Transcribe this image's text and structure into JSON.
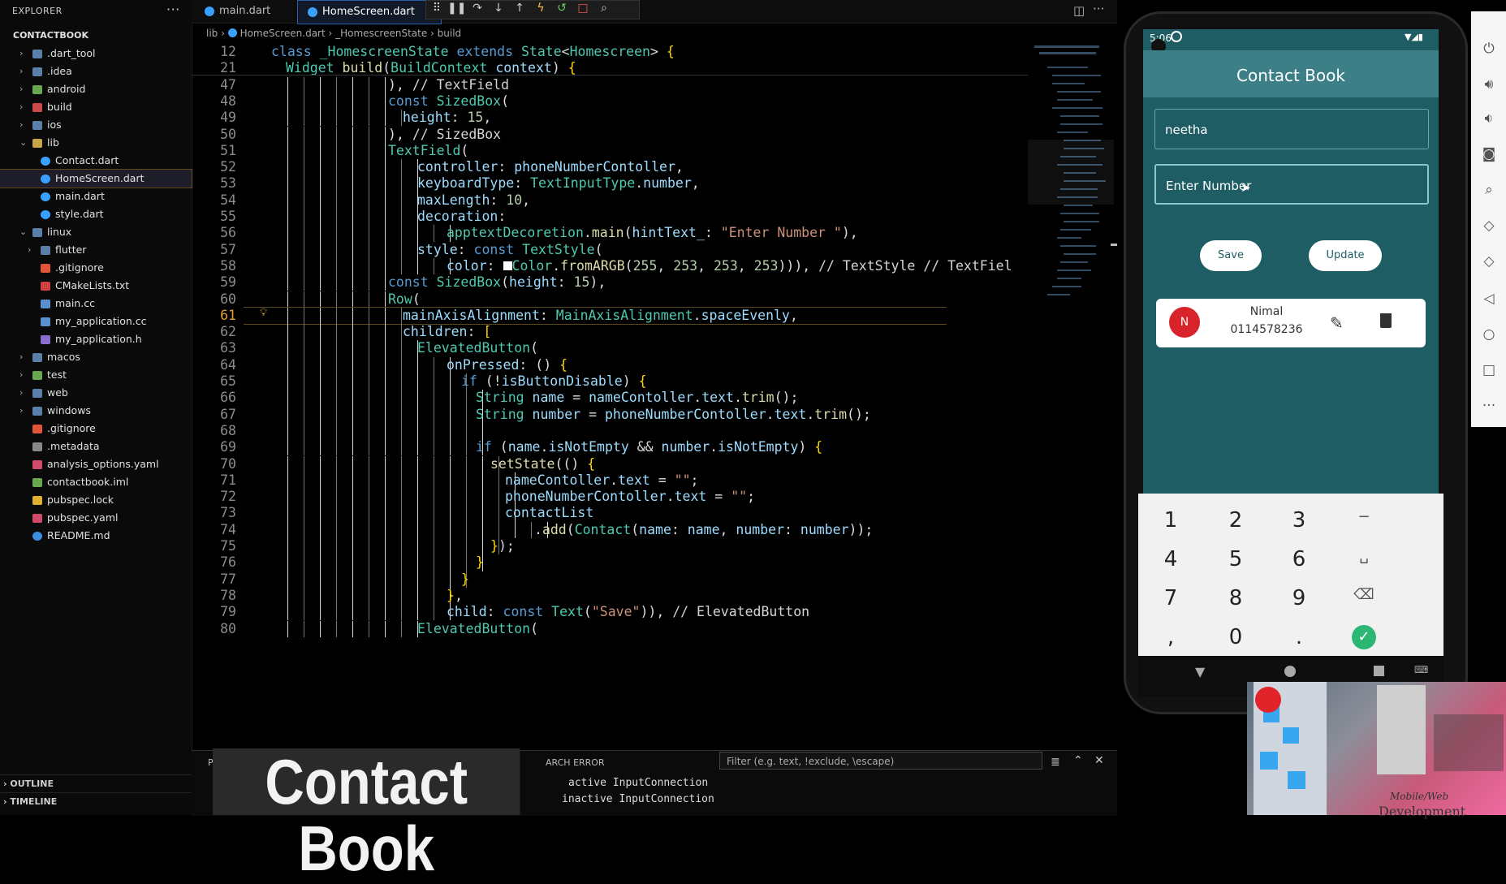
{
  "explorer": {
    "title": "EXPLORER",
    "more": "···",
    "items": [
      {
        "label": "CONTACTBOOK",
        "depth": 0,
        "chev": "v",
        "icon": "none",
        "bold": true
      },
      {
        "label": ".dart_tool",
        "depth": 1,
        "chev": ">",
        "icon": "folder"
      },
      {
        "label": ".idea",
        "depth": 1,
        "chev": ">",
        "icon": "folder"
      },
      {
        "label": "android",
        "depth": 1,
        "chev": ">",
        "icon": "folder-green"
      },
      {
        "label": "build",
        "depth": 1,
        "chev": ">",
        "icon": "folder-red"
      },
      {
        "label": "ios",
        "depth": 1,
        "chev": ">",
        "icon": "folder"
      },
      {
        "label": "lib",
        "depth": 1,
        "chev": "v",
        "icon": "folder-open"
      },
      {
        "label": "Contact.dart",
        "depth": 2,
        "chev": "",
        "icon": "dart"
      },
      {
        "label": "HomeScreen.dart",
        "depth": 2,
        "chev": "",
        "icon": "dart",
        "active": true
      },
      {
        "label": "main.dart",
        "depth": 2,
        "chev": "",
        "icon": "dart"
      },
      {
        "label": "style.dart",
        "depth": 2,
        "chev": "",
        "icon": "dart"
      },
      {
        "label": "linux",
        "depth": 1,
        "chev": "v",
        "icon": "folder"
      },
      {
        "label": "flutter",
        "depth": 2,
        "chev": ">",
        "icon": "folder"
      },
      {
        "label": ".gitignore",
        "depth": 2,
        "chev": "",
        "icon": "git"
      },
      {
        "label": "CMakeLists.txt",
        "depth": 2,
        "chev": "",
        "icon": "cmake"
      },
      {
        "label": "main.cc",
        "depth": 2,
        "chev": "",
        "icon": "cpp"
      },
      {
        "label": "my_application.cc",
        "depth": 2,
        "chev": "",
        "icon": "cpp"
      },
      {
        "label": "my_application.h",
        "depth": 2,
        "chev": "",
        "icon": "h"
      },
      {
        "label": "macos",
        "depth": 1,
        "chev": ">",
        "icon": "folder"
      },
      {
        "label": "test",
        "depth": 1,
        "chev": ">",
        "icon": "folder-green"
      },
      {
        "label": "web",
        "depth": 1,
        "chev": ">",
        "icon": "folder"
      },
      {
        "label": "windows",
        "depth": 1,
        "chev": ">",
        "icon": "folder"
      },
      {
        "label": ".gitignore",
        "depth": 1,
        "chev": "",
        "icon": "git"
      },
      {
        "label": ".metadata",
        "depth": 1,
        "chev": "",
        "icon": "meta"
      },
      {
        "label": "analysis_options.yaml",
        "depth": 1,
        "chev": "",
        "icon": "yaml"
      },
      {
        "label": "contactbook.iml",
        "depth": 1,
        "chev": "",
        "icon": "iml"
      },
      {
        "label": "pubspec.lock",
        "depth": 1,
        "chev": "",
        "icon": "lock"
      },
      {
        "label": "pubspec.yaml",
        "depth": 1,
        "chev": "",
        "icon": "yaml"
      },
      {
        "label": "README.md",
        "depth": 1,
        "chev": "",
        "icon": "info"
      }
    ],
    "outline": "OUTLINE",
    "timeline": "TIMELINE"
  },
  "tabs": [
    {
      "label": "main.dart",
      "active": false
    },
    {
      "label": "HomeScreen.dart",
      "active": true,
      "close": "×"
    }
  ],
  "breadcrumb": {
    "p1": "lib",
    "p2": "HomeScreen.dart",
    "p3": "_HomescreenState",
    "p4": "build"
  },
  "code": [
    {
      "n": "12",
      "i": 0,
      "html": "<span class='kw'>class</span> <span class='ty'>_HomescreenState</span> <span class='kw'>extends</span> <span class='ty'>State</span>&lt;<span class='ty'>Homescreen</span>&gt; <span class='br'>{</span>"
    },
    {
      "n": "21",
      "i": 1,
      "html": "<span class='ty'>Widget</span> <span class='fn'>build</span>(<span class='ty'>BuildContext</span> <span class='pr'>context</span>) <span class='br'>{</span>"
    },
    {
      "n": "47",
      "i": 8,
      "html": "), <span class='cm'>// TextField</span>"
    },
    {
      "n": "48",
      "i": 8,
      "html": "<span class='kw'>const</span> <span class='ty'>SizedBox</span>("
    },
    {
      "n": "49",
      "i": 9,
      "html": "<span class='pr'>height</span>: <span class='num'>15</span>,"
    },
    {
      "n": "50",
      "i": 8,
      "html": "), <span class='cm'>// SizedBox</span>"
    },
    {
      "n": "51",
      "i": 8,
      "html": "<span class='ty'>TextField</span>("
    },
    {
      "n": "52",
      "i": 10,
      "html": "<span class='pr'>controller</span>: <span class='pr'>phoneNumberContoller</span>,"
    },
    {
      "n": "53",
      "i": 10,
      "html": "<span class='pr'>keyboardType</span>: <span class='ty'>TextInputType</span>.<span class='pr'>number</span>,"
    },
    {
      "n": "54",
      "i": 10,
      "html": "<span class='pr'>maxLength</span>: <span class='num'>10</span>,"
    },
    {
      "n": "55",
      "i": 10,
      "html": "<span class='pr'>decoration</span>:"
    },
    {
      "n": "56",
      "i": 12,
      "html": "<span class='ty'>apptextDecoretion</span>.<span class='fn'>main</span>(<span class='pr'>hintText_</span>: <span class='st'>\"Enter Number \"</span>),"
    },
    {
      "n": "57",
      "i": 10,
      "html": "<span class='pr'>style</span>: <span class='kw'>const</span> <span class='ty'>TextStyle</span>("
    },
    {
      "n": "58",
      "i": 12,
      "html": "<span class='pr'>color</span>: <span style='display:inline-block;width:11px;height:11px;background:#fff;'></span><span class='ty'>Color</span>.<span class='fn'>fromARGB</span>(<span class='num'>255</span>, <span class='num'>253</span>, <span class='num'>253</span>, <span class='num'>253</span>))), <span class='cm'>// TextStyle // TextFiel</span>"
    },
    {
      "n": "59",
      "i": 8,
      "html": "<span class='kw'>const</span> <span class='ty'>SizedBox</span>(<span class='pr'>height</span>: <span class='num'>15</span>),"
    },
    {
      "n": "60",
      "i": 8,
      "html": "<span class='ty'>Row</span>("
    },
    {
      "n": "61",
      "i": 9,
      "cur": true,
      "html": "<span class='pr'>mainAxisAlignment</span>: <span class='ty'>MainAxisAlignment</span>.<span class='pr'>spaceEvenly</span>,"
    },
    {
      "n": "62",
      "i": 9,
      "html": "<span class='pr'>children</span>: <span class='br'>[</span>"
    },
    {
      "n": "63",
      "i": 10,
      "html": "<span class='ty'>ElevatedButton</span>("
    },
    {
      "n": "64",
      "i": 12,
      "html": "<span class='pr'>onPressed</span>: () <span class='br'>{</span>"
    },
    {
      "n": "65",
      "i": 13,
      "html": "<span class='kw'>if</span> (!<span class='pr'>isButtonDisable</span>) <span class='br'>{</span>"
    },
    {
      "n": "66",
      "i": 14,
      "html": "<span class='ty'>String</span> <span class='pr'>name</span> = <span class='pr'>nameContoller</span>.<span class='pr'>text</span>.<span class='fn'>trim</span>();"
    },
    {
      "n": "67",
      "i": 14,
      "html": "<span class='ty'>String</span> <span class='pr'>number</span> = <span class='pr'>phoneNumberContoller</span>.<span class='pr'>text</span>.<span class='fn'>trim</span>();"
    },
    {
      "n": "68",
      "i": 14,
      "html": ""
    },
    {
      "n": "69",
      "i": 14,
      "html": "<span class='kw'>if</span> (<span class='pr'>name</span>.<span class='pr'>isNotEmpty</span> &amp;&amp; <span class='pr'>number</span>.<span class='pr'>isNotEmpty</span>) <span class='br'>{</span>"
    },
    {
      "n": "70",
      "i": 15,
      "html": "<span class='fn'>setState</span>(() <span class='br'>{</span>"
    },
    {
      "n": "71",
      "i": 16,
      "html": "<span class='pr'>nameContoller</span>.<span class='pr'>text</span> = <span class='st'>\"\"</span>;"
    },
    {
      "n": "72",
      "i": 16,
      "html": "<span class='pr'>phoneNumberContoller</span>.<span class='pr'>text</span> = <span class='st'>\"\"</span>;"
    },
    {
      "n": "73",
      "i": 16,
      "html": "<span class='pr'>contactList</span>"
    },
    {
      "n": "74",
      "i": 18,
      "html": ".<span class='fn'>add</span>(<span class='ty'>Contact</span>(<span class='pr'>name</span>: <span class='pr'>name</span>, <span class='pr'>number</span>: <span class='pr'>number</span>));"
    },
    {
      "n": "75",
      "i": 15,
      "html": "<span class='br'>}</span>);"
    },
    {
      "n": "76",
      "i": 14,
      "html": "<span class='br'>}</span>"
    },
    {
      "n": "77",
      "i": 13,
      "html": "<span class='br'>}</span>"
    },
    {
      "n": "78",
      "i": 12,
      "html": "<span class='br'>}</span>,"
    },
    {
      "n": "79",
      "i": 12,
      "html": "<span class='pr'>child</span>: <span class='kw'>const</span> <span class='ty'>Text</span>(<span class='st'>\"Save\"</span>)), <span class='cm'>// ElevatedButton</span>"
    },
    {
      "n": "80",
      "i": 10,
      "html": "<span class='ty'>ElevatedButton</span>("
    }
  ],
  "panel": {
    "tab_partial": "PRO",
    "search_error": "ARCH ERROR",
    "filter_placeholder": "Filter (e.g. text, !exclude, \\escape)",
    "log1": "active InputConnection",
    "log2": "inactive InputConnection"
  },
  "overlay_title": "Contact Book",
  "phone": {
    "status_time": "5:06",
    "app_title": "Contact Book",
    "name_value": "neetha",
    "number_placeholder": "Enter Number",
    "save": "Save",
    "update": "Update",
    "contact": {
      "initial": "N",
      "name": "Nimal",
      "number": "0114578236"
    },
    "keys": [
      "1",
      "2",
      "3",
      "−",
      "4",
      "5",
      "6",
      "␣",
      "7",
      "8",
      "9",
      "⌫",
      ",",
      "0",
      ".",
      "✓"
    ]
  },
  "webcam": {
    "line1": "Mobile/Web",
    "line2": "Development"
  },
  "colors": {
    "app_bg": "#1f5d65",
    "appbar": "#3d7f87",
    "avatar": "#d8232a",
    "done_key": "#2bb673"
  }
}
